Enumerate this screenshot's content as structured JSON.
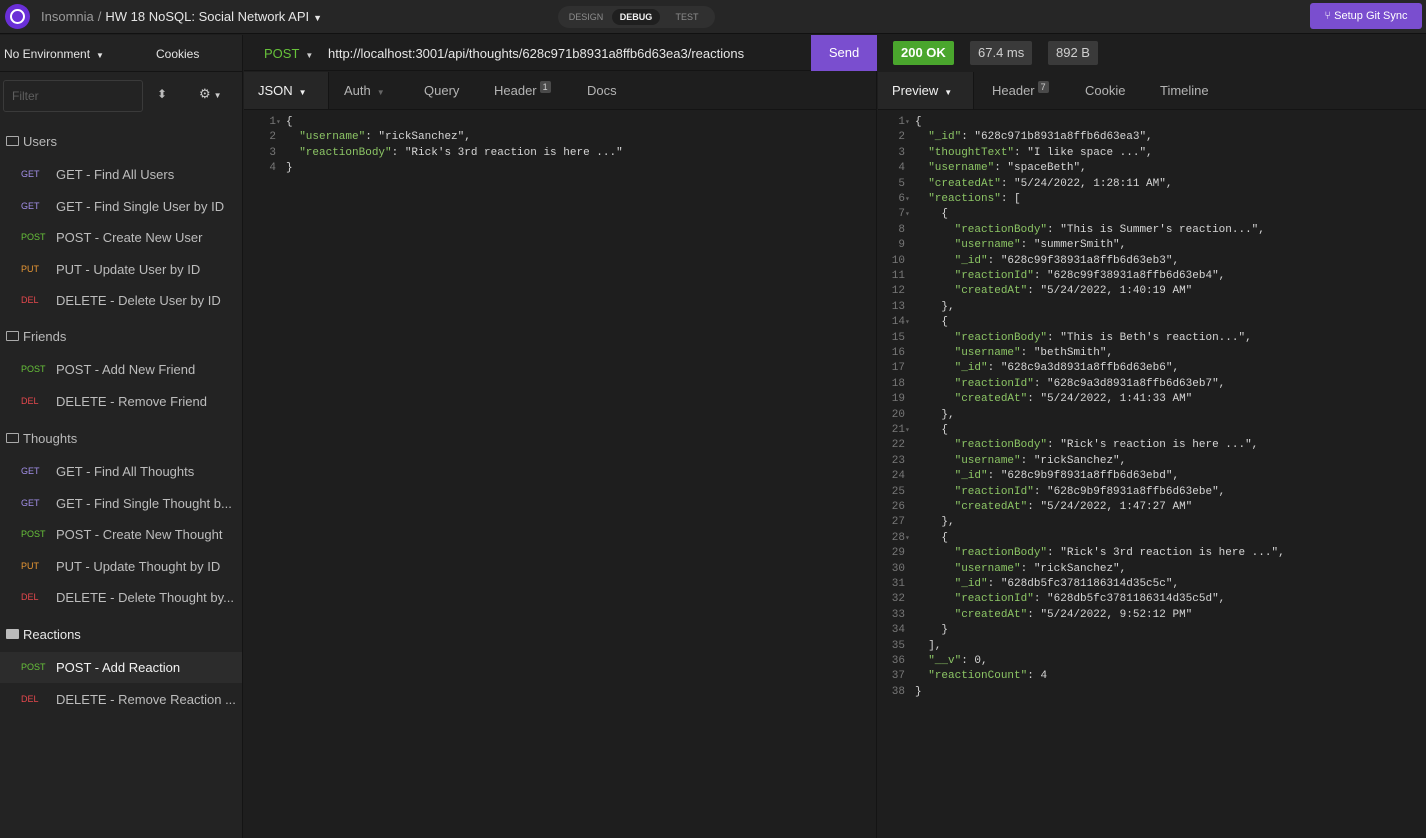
{
  "app": {
    "name": "Insomnia",
    "project": "HW 18 NoSQL: Social Network API"
  },
  "modes": [
    "DESIGN",
    "DEBUG",
    "TEST"
  ],
  "active_mode": "DEBUG",
  "git_sync_label": "Setup Git Sync",
  "sidebar": {
    "environment": "No Environment",
    "cookies": "Cookies",
    "filter_placeholder": "Filter",
    "folders": [
      {
        "name": "Users",
        "items": [
          {
            "method": "GET",
            "name": "GET - Find All Users"
          },
          {
            "method": "GET",
            "name": "GET - Find Single User by ID"
          },
          {
            "method": "POST",
            "name": "POST - Create New User"
          },
          {
            "method": "PUT",
            "name": "PUT - Update User by ID"
          },
          {
            "method": "DEL",
            "name": "DELETE - Delete User by ID"
          }
        ]
      },
      {
        "name": "Friends",
        "items": [
          {
            "method": "POST",
            "name": "POST - Add New Friend"
          },
          {
            "method": "DEL",
            "name": "DELETE - Remove Friend"
          }
        ]
      },
      {
        "name": "Thoughts",
        "items": [
          {
            "method": "GET",
            "name": "GET - Find All Thoughts"
          },
          {
            "method": "GET",
            "name": "GET - Find Single Thought b..."
          },
          {
            "method": "POST",
            "name": "POST - Create New Thought"
          },
          {
            "method": "PUT",
            "name": "PUT - Update Thought by ID"
          },
          {
            "method": "DEL",
            "name": "DELETE - Delete Thought by..."
          }
        ]
      },
      {
        "name": "Reactions",
        "items": [
          {
            "method": "POST",
            "name": "POST - Add Reaction"
          },
          {
            "method": "DEL",
            "name": "DELETE - Remove Reaction ..."
          }
        ]
      }
    ]
  },
  "request": {
    "method": "POST",
    "url": "http://localhost:3001/api/thoughts/628c971b8931a8ffb6d63ea3/reactions",
    "send_label": "Send",
    "tabs": {
      "body": "JSON",
      "auth": "Auth",
      "query": "Query",
      "header": "Header",
      "header_count": "1",
      "docs": "Docs"
    },
    "body_lines": [
      "{",
      "  \"username\": \"rickSanchez\",",
      "  \"reactionBody\": \"Rick's 3rd reaction is here ...\"",
      "}"
    ]
  },
  "response": {
    "status": "200 OK",
    "time": "67.4 ms",
    "size": "892 B",
    "tabs": {
      "preview": "Preview",
      "header": "Header",
      "header_count": "7",
      "cookie": "Cookie",
      "timeline": "Timeline"
    },
    "body_lines": [
      "{",
      "  \"_id\": \"628c971b8931a8ffb6d63ea3\",",
      "  \"thoughtText\": \"I like space ...\",",
      "  \"username\": \"spaceBeth\",",
      "  \"createdAt\": \"5/24/2022, 1:28:11 AM\",",
      "  \"reactions\": [",
      "    {",
      "      \"reactionBody\": \"This is Summer's reaction...\",",
      "      \"username\": \"summerSmith\",",
      "      \"_id\": \"628c99f38931a8ffb6d63eb3\",",
      "      \"reactionId\": \"628c99f38931a8ffb6d63eb4\",",
      "      \"createdAt\": \"5/24/2022, 1:40:19 AM\"",
      "    },",
      "    {",
      "      \"reactionBody\": \"This is Beth's reaction...\",",
      "      \"username\": \"bethSmith\",",
      "      \"_id\": \"628c9a3d8931a8ffb6d63eb6\",",
      "      \"reactionId\": \"628c9a3d8931a8ffb6d63eb7\",",
      "      \"createdAt\": \"5/24/2022, 1:41:33 AM\"",
      "    },",
      "    {",
      "      \"reactionBody\": \"Rick's reaction is here ...\",",
      "      \"username\": \"rickSanchez\",",
      "      \"_id\": \"628c9b9f8931a8ffb6d63ebd\",",
      "      \"reactionId\": \"628c9b9f8931a8ffb6d63ebe\",",
      "      \"createdAt\": \"5/24/2022, 1:47:27 AM\"",
      "    },",
      "    {",
      "      \"reactionBody\": \"Rick's 3rd reaction is here ...\",",
      "      \"username\": \"rickSanchez\",",
      "      \"_id\": \"628db5fc3781186314d35c5c\",",
      "      \"reactionId\": \"628db5fc3781186314d35c5d\",",
      "      \"createdAt\": \"5/24/2022, 9:52:12 PM\"",
      "    }",
      "  ],",
      "  \"__v\": 0,",
      "  \"reactionCount\": 4",
      "}"
    ],
    "fold_lines": [
      1,
      6,
      7,
      14,
      21,
      28
    ]
  },
  "colors": {
    "accent": "#7a4ecf",
    "get": "#a28fe8",
    "post": "#67c23a",
    "put": "#e89734",
    "delete": "#e5484d",
    "status_ok": "#4aa62d"
  }
}
